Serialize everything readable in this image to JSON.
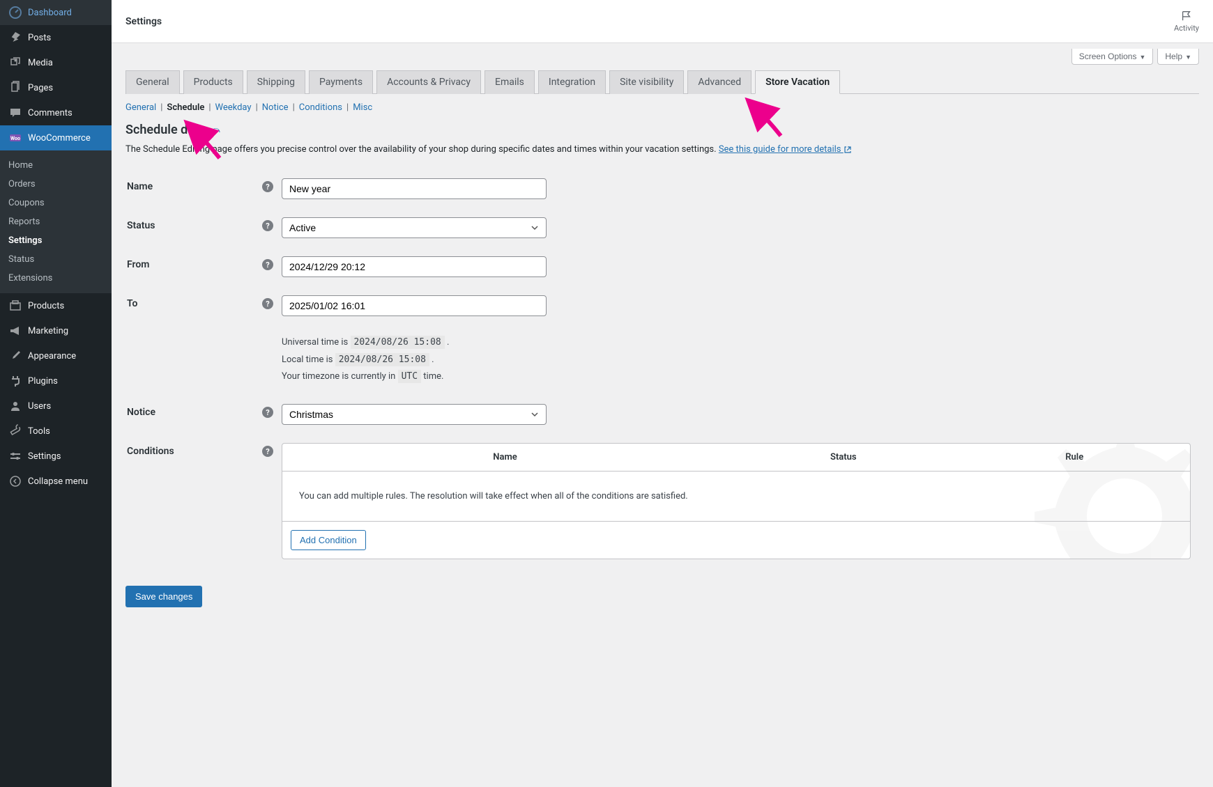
{
  "sidebar": {
    "items": [
      {
        "label": "Dashboard",
        "icon": "dashboard"
      },
      {
        "label": "Posts",
        "icon": "pin"
      },
      {
        "label": "Media",
        "icon": "media"
      },
      {
        "label": "Pages",
        "icon": "page"
      },
      {
        "label": "Comments",
        "icon": "comment"
      },
      {
        "label": "WooCommerce",
        "icon": "woo",
        "active": true
      },
      {
        "label": "Products",
        "icon": "cart"
      },
      {
        "label": "Marketing",
        "icon": "megaphone"
      },
      {
        "label": "Appearance",
        "icon": "brush"
      },
      {
        "label": "Plugins",
        "icon": "plug"
      },
      {
        "label": "Users",
        "icon": "user"
      },
      {
        "label": "Tools",
        "icon": "wrench"
      },
      {
        "label": "Settings",
        "icon": "gear"
      },
      {
        "label": "Collapse menu",
        "icon": "collapse"
      }
    ],
    "woo_sub": [
      "Home",
      "Orders",
      "Coupons",
      "Reports",
      "Settings",
      "Status",
      "Extensions"
    ],
    "woo_sub_active": "Settings"
  },
  "top": {
    "title": "Settings",
    "activity": "Activity",
    "screen_options": "Screen Options",
    "help": "Help"
  },
  "tabs": [
    "General",
    "Products",
    "Shipping",
    "Payments",
    "Accounts & Privacy",
    "Emails",
    "Integration",
    "Site visibility",
    "Advanced",
    "Store Vacation"
  ],
  "active_tab": "Store Vacation",
  "subsub": [
    "General",
    "Schedule",
    "Weekday",
    "Notice",
    "Conditions",
    "Misc"
  ],
  "subsub_active": "Schedule",
  "heading": "Schedule data",
  "description": "The Schedule Editing page offers you precise control over the availability of your shop during specific dates and times within your vacation settings.",
  "guide_link": "See this guide for more details",
  "fields": {
    "name": {
      "label": "Name",
      "value": "New year"
    },
    "status": {
      "label": "Status",
      "value": "Active"
    },
    "from": {
      "label": "From",
      "value": "2024/12/29 20:12"
    },
    "to": {
      "label": "To",
      "value": "2025/01/02 16:01"
    },
    "notice": {
      "label": "Notice",
      "value": "Christmas"
    },
    "conditions": {
      "label": "Conditions"
    }
  },
  "time_info": {
    "utc_prefix": "Universal time is",
    "utc_value": "2024/08/26 15:08",
    "local_prefix": "Local time is",
    "local_value": "2024/08/26 15:08",
    "tz_prefix": "Your timezone is currently in",
    "tz_value": "UTC",
    "tz_suffix": "time."
  },
  "cond_table": {
    "head": {
      "name": "Name",
      "status": "Status",
      "rule": "Rule"
    },
    "empty_msg": "You can add multiple rules. The resolution will take effect when all of the conditions are satisfied.",
    "add_btn": "Add Condition"
  },
  "save_btn": "Save changes"
}
